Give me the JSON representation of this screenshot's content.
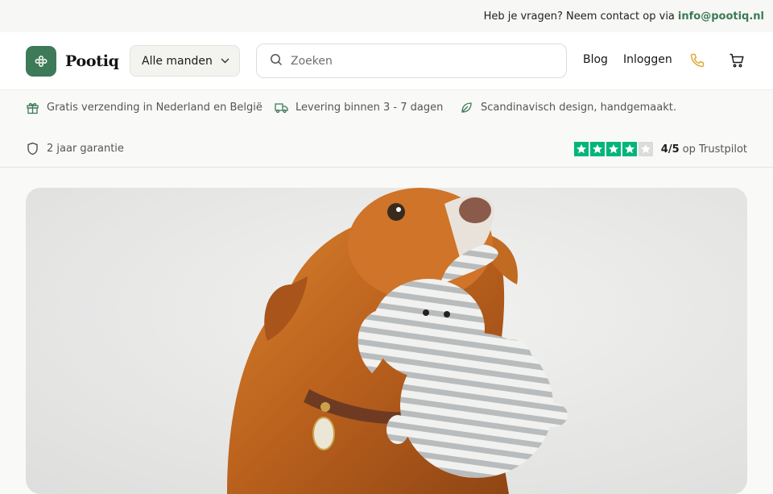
{
  "topbar": {
    "text": "Heb je vragen? Neem contact op via",
    "email": "info@pootiq.nl"
  },
  "header": {
    "brand": "Pootiq",
    "category_dropdown": "Alle manden",
    "search_placeholder": "Zoeken",
    "nav": {
      "blog": "Blog",
      "login": "Inloggen"
    }
  },
  "usps": [
    {
      "icon": "gift-icon",
      "text": "Gratis verzending in Nederland en België"
    },
    {
      "icon": "truck-icon",
      "text": "Levering binnen 3 - 7 dagen"
    },
    {
      "icon": "leaf-icon",
      "text": "Scandinavisch design, handgemaakt."
    },
    {
      "icon": "shield-icon",
      "text": "2 jaar garantie"
    }
  ],
  "trustpilot": {
    "score": "4/5",
    "suffix": "op Trustpilot",
    "stars_filled": 4,
    "stars_total": 5
  },
  "colors": {
    "brand_green": "#3d7a58",
    "trustpilot_green": "#00b67a",
    "phone_accent": "#e0a93a"
  },
  "hero": {
    "image": "dog-with-knitted-elephant-toy"
  }
}
